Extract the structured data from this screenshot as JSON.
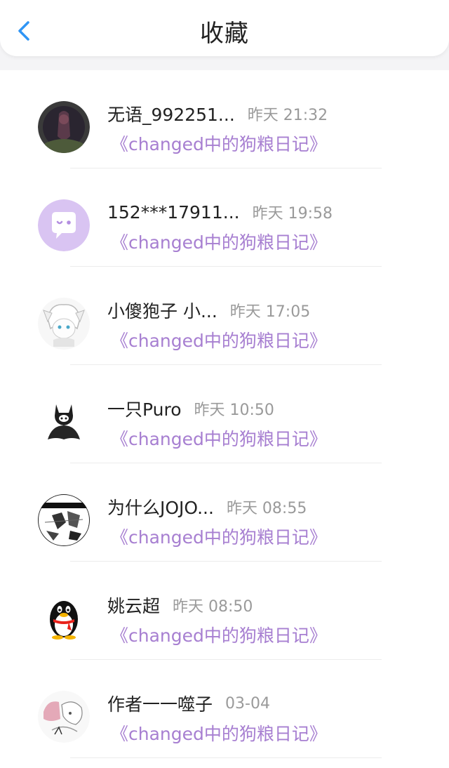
{
  "header": {
    "title": "收藏",
    "back_icon": "chevron-left-icon",
    "accent_color": "#2f95f5"
  },
  "colors": {
    "link": "#a77fd1",
    "time": "#9a9a9a"
  },
  "items": [
    {
      "name": "无语_992251...",
      "time": "昨天 21:32",
      "title": "《changed中的狗粮日记》",
      "avatar": "dark-figure-avatar"
    },
    {
      "name": "152***17911...",
      "time": "昨天 19:58",
      "title": "《changed中的狗粮日记》",
      "avatar": "chat-bubble-avatar"
    },
    {
      "name": "小傻狍子 小...",
      "time": "昨天 17:05",
      "title": "《changed中的狗粮日记》",
      "avatar": "anime-white-hair-avatar"
    },
    {
      "name": "一只Puro",
      "time": "昨天 10:50",
      "title": "《changed中的狗粮日记》",
      "avatar": "puro-avatar"
    },
    {
      "name": "为什么JOJO...",
      "time": "昨天 08:55",
      "title": "《changed中的狗粮日记》",
      "avatar": "manga-avatar"
    },
    {
      "name": "姚云超",
      "time": "昨天 08:50",
      "title": "《changed中的狗粮日记》",
      "avatar": "qq-penguin-avatar"
    },
    {
      "name": "作者一一噬子",
      "time": "03-04",
      "title": "《changed中的狗粮日记》",
      "avatar": "sketch-avatar"
    }
  ]
}
